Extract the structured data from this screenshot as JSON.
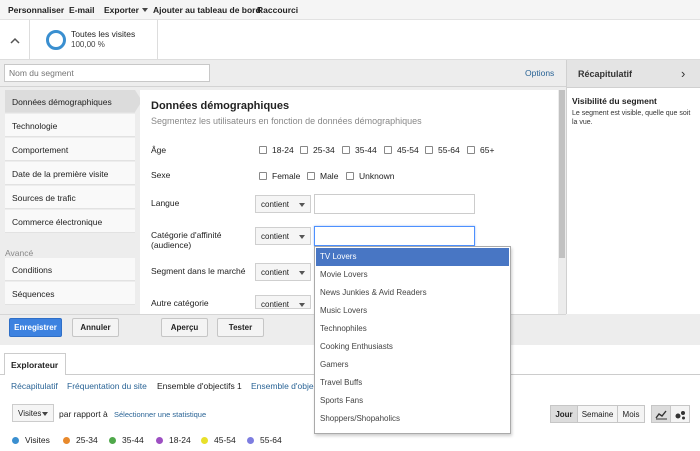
{
  "toolbar": {
    "items": [
      "Personnaliser",
      "E-mail",
      "Exporter",
      "Ajouter au tableau de bord",
      "Raccourci"
    ]
  },
  "segment_bar": {
    "title": "Toutes les visites",
    "percent": "100,00 %"
  },
  "editor": {
    "name_placeholder": "Nom du segment",
    "options_label": "Options",
    "summary": {
      "title": "Récapitulatif",
      "visibility_title": "Visibilité du segment",
      "visibility_text": "Le segment est visible, quelle que soit la vue."
    },
    "sidebar": {
      "items": [
        "Données démographiques",
        "Technologie",
        "Comportement",
        "Date de la première visite",
        "Sources de trafic",
        "Commerce électronique"
      ],
      "advanced_header": "Avancé",
      "advanced_items": [
        "Conditions",
        "Séquences"
      ]
    },
    "content": {
      "title": "Données démographiques",
      "subtitle": "Segmentez les utilisateurs en fonction de données démographiques",
      "age_label": "Âge",
      "age_options": [
        "18-24",
        "25-34",
        "35-44",
        "45-54",
        "55-64",
        "65+"
      ],
      "sex_label": "Sexe",
      "sex_options": [
        "Female",
        "Male",
        "Unknown"
      ],
      "language_label": "Langue",
      "affinity_label": "Catégorie d'affinité (audience)",
      "market_label": "Segment dans le marché",
      "other_label": "Autre catégorie",
      "operator": "contient",
      "affinity_value": ""
    },
    "dropdown": {
      "items": [
        "TV Lovers",
        "Movie Lovers",
        "News Junkies & Avid Readers",
        "Music Lovers",
        "Technophiles",
        "Cooking Enthusiasts",
        "Gamers",
        "Travel Buffs",
        "Sports Fans",
        "Shoppers/Shopaholics"
      ],
      "highlighted": "TV Lovers"
    },
    "actions": {
      "save": "Enregistrer",
      "cancel": "Annuler",
      "preview": "Aperçu",
      "test": "Tester"
    }
  },
  "explorer": {
    "tab": "Explorateur",
    "subtabs": [
      "Récapitulatif",
      "Fréquentation du site",
      "Ensemble d'objectifs 1",
      "Ensemble d'objec"
    ],
    "current_subtab": "Ensemble d'objectifs 1",
    "metric": "Visites",
    "vs_label": "par rapport à",
    "select_metric": "Sélectionner une statistique",
    "periods": [
      "Jour",
      "Semaine",
      "Mois"
    ],
    "active_period": "Jour",
    "legend": [
      {
        "label": "Visites",
        "color": "#3a8fd0"
      },
      {
        "label": "25-34",
        "color": "#e8892c"
      },
      {
        "label": "35-44",
        "color": "#4fa84a"
      },
      {
        "label": "18-24",
        "color": "#9d4fc2"
      },
      {
        "label": "45-54",
        "color": "#e8e02a"
      },
      {
        "label": "55-64",
        "color": "#7d7de0"
      }
    ]
  },
  "colors": {
    "accent": "#3d82e0",
    "link": "#2a6496",
    "dropdown_highlight": "#4876c4"
  }
}
